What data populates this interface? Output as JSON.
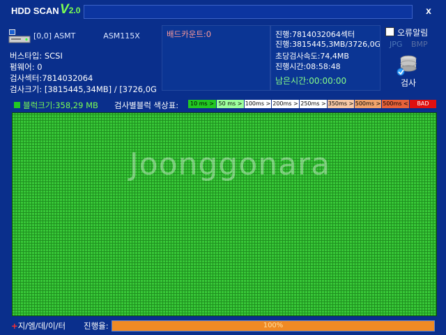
{
  "window": {
    "title": "HDD SCAN",
    "version_prefix": "V",
    "version_number": "2.0",
    "close_label": "x"
  },
  "device": {
    "port": "[0,0] ASMT",
    "model": "ASM115X"
  },
  "info": {
    "bus_type": "버스타입: SCSI",
    "firmware": "펌웨어: 0",
    "scan_sectors": "검사섹터:7814032064",
    "scan_size": "검사크기: [3815445,34MB] / [3726,0GI"
  },
  "bad": {
    "count_label": "배드카운트:0"
  },
  "progress_info": {
    "sector": "진행:7814032064섹터",
    "size": "진행:3815445,3MB/3726,0GI",
    "speed": "초당검사속도:74,4MB",
    "elapsed": "진행시간:08:58:48",
    "remaining": "남은시간:00:00:00"
  },
  "options": {
    "error_alarm": "오류알림",
    "jpg": "JPG",
    "bmp": "BMP",
    "scan_button": "검사"
  },
  "block": {
    "size_label": "블럭크기:358,29 MB"
  },
  "legend": {
    "label": "검사별블럭 색상표:",
    "items": [
      {
        "label": "10 ms >",
        "color": "#22c822"
      },
      {
        "label": "50 ms >",
        "color": "#9dff9d"
      },
      {
        "label": "100ms >",
        "color": "#ffffff"
      },
      {
        "label": "200ms >",
        "color": "#ffffff"
      },
      {
        "label": "250ms >",
        "color": "#ffffff"
      },
      {
        "label": "350ms >",
        "color": "#f7c9a6"
      },
      {
        "label": "500ms >",
        "color": "#f0a46c"
      },
      {
        "label": "500ms <",
        "color": "#e8623a"
      },
      {
        "label": "BAD",
        "color": "#e01010"
      }
    ]
  },
  "footer": {
    "brand_plus": "+",
    "brand": "지/엠/데/이/터",
    "progress_label": "진행율:",
    "progress_value": 1.0,
    "progress_text": "100%"
  },
  "watermark": "Joonggonara",
  "colors": {
    "background": "#0a2f8c",
    "block_ok": "#38c838",
    "progress": "#f08a24"
  }
}
